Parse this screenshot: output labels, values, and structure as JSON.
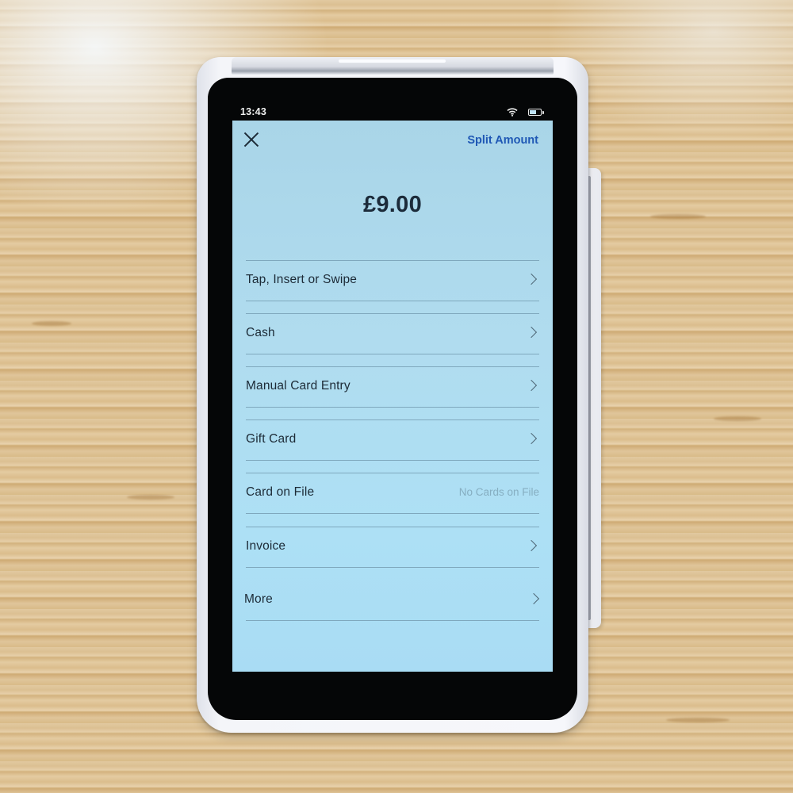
{
  "status_bar": {
    "time": "13:43",
    "wifi_icon": "wifi-icon",
    "battery_icon": "battery-icon"
  },
  "header": {
    "close_icon": "close-icon",
    "split_amount_label": "Split Amount"
  },
  "amount": "£9.00",
  "payment_methods": [
    {
      "label": "Tap, Insert or Swipe",
      "trailing": "chevron-right-icon"
    },
    {
      "label": "Cash",
      "trailing": "chevron-right-icon"
    },
    {
      "label": "Manual Card Entry",
      "trailing": "chevron-right-icon"
    },
    {
      "label": "Gift Card",
      "trailing": "chevron-right-icon"
    },
    {
      "label": "Card on File",
      "secondary": "No Cards on File"
    },
    {
      "label": "Invoice",
      "trailing": "chevron-right-icon"
    },
    {
      "label": "More",
      "trailing": "chevron-right-icon"
    }
  ],
  "colors": {
    "accent": "#1f58b5",
    "screen_background": "#ade0f5",
    "text_primary": "#1c2a36",
    "text_secondary": "#86aec1",
    "divider": "#7fa8bd"
  }
}
